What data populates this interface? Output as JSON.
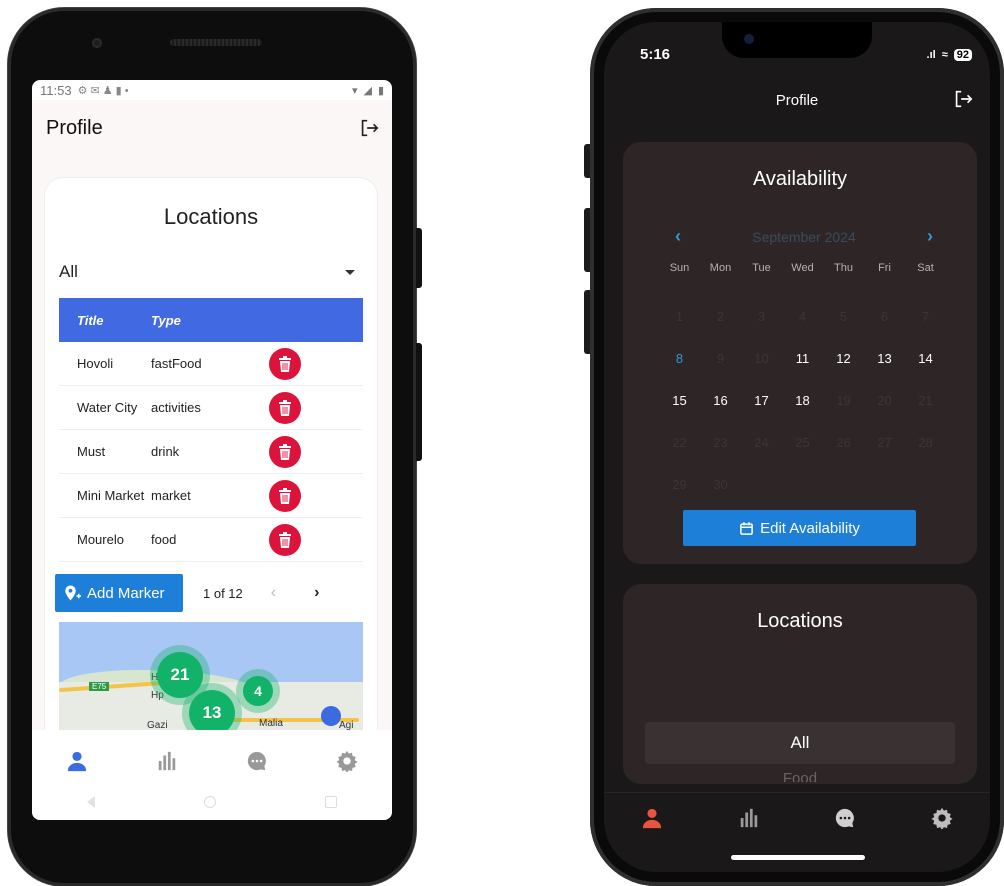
{
  "android": {
    "status": {
      "time": "11:53"
    },
    "header": {
      "title": "Profile"
    },
    "locations": {
      "title": "Locations",
      "filter_value": "All",
      "columns": [
        "Title",
        "Type"
      ],
      "rows": [
        {
          "title": "Hovoli",
          "type": "fastFood"
        },
        {
          "title": "Water City",
          "type": "activities"
        },
        {
          "title": "Must",
          "type": "drink"
        },
        {
          "title": "Mini Market",
          "type": "market"
        },
        {
          "title": "Mourelo",
          "type": "food"
        }
      ],
      "add_button_label": "Add Marker",
      "page_label": "1 of 12",
      "prev_label": "‹",
      "next_label": "›"
    },
    "map": {
      "road_label": "E75",
      "clusters": [
        "21",
        "13",
        "4"
      ],
      "labels": [
        "Gazi",
        "Malia",
        "Agi",
        "H",
        "Hp"
      ]
    },
    "colors": {
      "table_header": "#4169e1",
      "delete": "#dc143c",
      "primary": "#1e7fd9",
      "cluster": "#12b369",
      "active_tab": "#3b6be0"
    }
  },
  "iphone": {
    "status": {
      "time": "5:16",
      "battery": "92"
    },
    "header": {
      "title": "Profile"
    },
    "availability": {
      "title": "Availability",
      "month_label": "September 2024",
      "weekdays": [
        "Sun",
        "Mon",
        "Tue",
        "Wed",
        "Thu",
        "Fri",
        "Sat"
      ],
      "weeks": [
        [
          "1",
          "2",
          "3",
          "4",
          "5",
          "6",
          "7"
        ],
        [
          "8",
          "9",
          "10",
          "11",
          "12",
          "13",
          "14"
        ],
        [
          "15",
          "16",
          "17",
          "18",
          "19",
          "20",
          "21"
        ],
        [
          "22",
          "23",
          "24",
          "25",
          "26",
          "27",
          "28"
        ],
        [
          "29",
          "30",
          "",
          "",
          "",
          "",
          ""
        ]
      ],
      "today": "8",
      "enabled_days": [
        "11",
        "12",
        "13",
        "14",
        "15",
        "16",
        "17",
        "18"
      ],
      "edit_button_label": "Edit Availability"
    },
    "locations": {
      "title": "Locations",
      "filter_value": "All",
      "next_option_peek": "Food"
    },
    "colors": {
      "background": "#1a1818",
      "card": "#2e2626",
      "accent": "#2d9ad6",
      "primary": "#1e7fd9",
      "active_tab": "#e8553e"
    }
  },
  "tabbar_icons": [
    "person-icon",
    "bar-chart-icon",
    "chat-icon",
    "gear-icon"
  ]
}
